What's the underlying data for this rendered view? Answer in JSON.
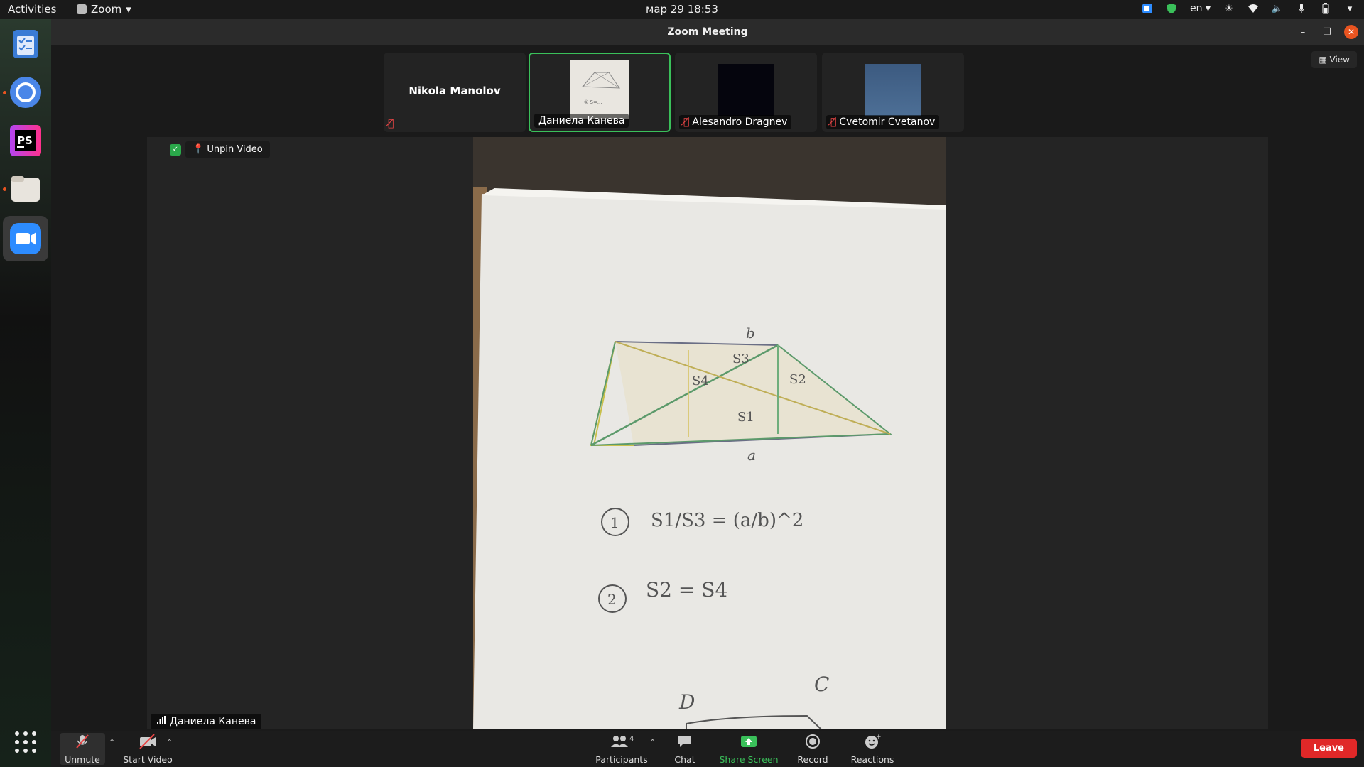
{
  "topbar": {
    "activities": "Activities",
    "app_menu": "Zoom",
    "clock": "мар 29  18:53",
    "lang": "en"
  },
  "window": {
    "title": "Zoom Meeting",
    "view_label": "View"
  },
  "participants_strip": [
    {
      "name": "Nikola Manolov",
      "muted": true,
      "video": false
    },
    {
      "name": "Даниела Канева",
      "muted": false,
      "video": true,
      "active": true
    },
    {
      "name": "Alesandro Dragnev",
      "muted": true,
      "video": true
    },
    {
      "name": "Cvetomir Cvetanov",
      "muted": true,
      "video": true
    }
  ],
  "main_video": {
    "unpin_label": "Unpin Video",
    "speaker_name": "Даниела Канева",
    "whiteboard": {
      "top_label": "b",
      "bottom_label": "a",
      "regions": [
        "S3",
        "S4",
        "S2",
        "S1"
      ],
      "eq1_num": "1",
      "eq1": "S1/S3 = (a/b)^2",
      "eq2_num": "2",
      "eq2": "S2 = S4",
      "letter_d": "D",
      "letter_c": "C"
    }
  },
  "toolbar": {
    "unmute": "Unmute",
    "start_video": "Start Video",
    "participants": "Participants",
    "participants_count": "4",
    "chat": "Chat",
    "share_screen": "Share Screen",
    "record": "Record",
    "reactions": "Reactions",
    "leave": "Leave"
  }
}
